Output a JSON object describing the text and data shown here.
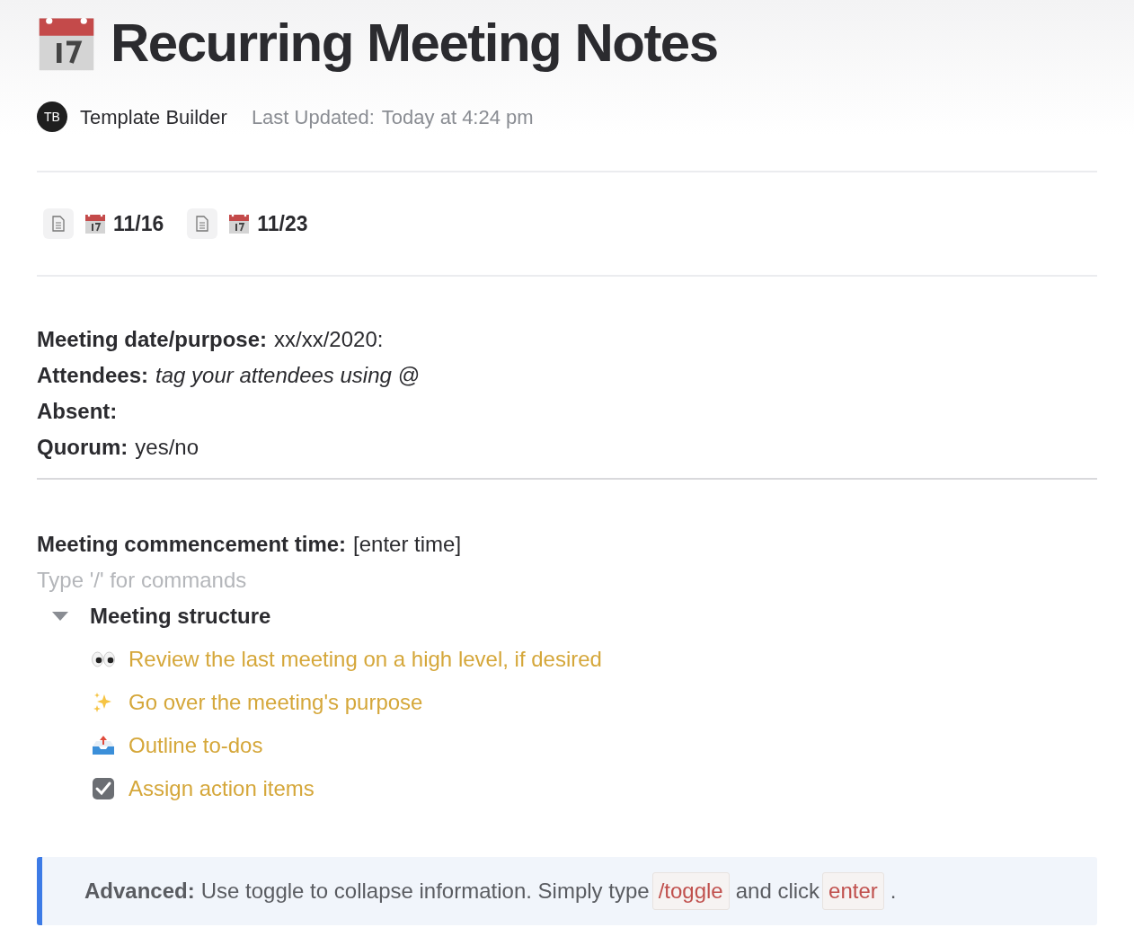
{
  "title": "Recurring Meeting Notes",
  "author": {
    "initials": "TB",
    "name": "Template Builder"
  },
  "last_updated": {
    "label": "Last Updated:",
    "value": "Today at 4:24 pm"
  },
  "linked_pages": [
    {
      "label": "11/16"
    },
    {
      "label": "11/23"
    }
  ],
  "fields": [
    {
      "label": "Meeting date/purpose:",
      "value": "xx/xx/2020:",
      "kind": "plain"
    },
    {
      "label": "Attendees:",
      "value": "tag your attendees using @",
      "kind": "italic"
    },
    {
      "label": "Absent:"
    },
    {
      "label": "Quorum:",
      "value": "yes/no",
      "kind": "plain"
    }
  ],
  "commencement": {
    "label": "Meeting commencement time:",
    "value": "[enter time]"
  },
  "placeholder": "Type '/' for commands",
  "toggle": {
    "label": "Meeting structure",
    "expanded": true,
    "items": [
      {
        "kind": "eyes",
        "text": "Review the last meeting on a high level, if desired"
      },
      {
        "kind": "sparkles",
        "text": "Go over the meeting's purpose"
      },
      {
        "kind": "outbox",
        "text": "Outline to-dos"
      },
      {
        "kind": "check",
        "text": "Assign action items"
      }
    ]
  },
  "callout": {
    "parts": [
      {
        "kind": "bold",
        "text": "Advanced:"
      },
      {
        "kind": "text",
        "text": "Use toggle to collapse information. Simply type"
      },
      {
        "kind": "code",
        "text": "/toggle"
      },
      {
        "kind": "text",
        "text": "and click"
      },
      {
        "kind": "code",
        "text": "enter"
      },
      {
        "kind": "text",
        "text": "."
      }
    ]
  }
}
